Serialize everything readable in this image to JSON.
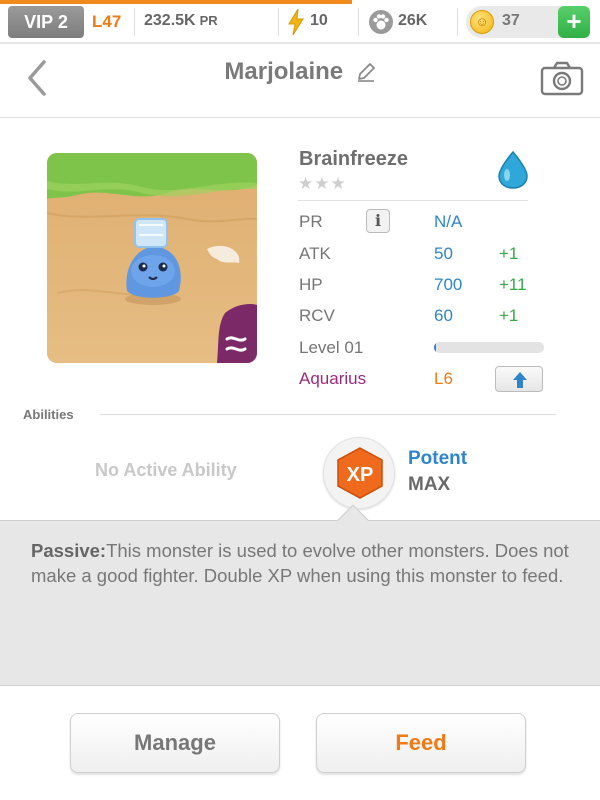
{
  "topbar": {
    "vip": "VIP 2",
    "level": "L47",
    "pr_value": "232.5K",
    "pr_unit": "PR",
    "energy": "10",
    "food": "26K",
    "coins": "37",
    "plus": "+"
  },
  "header": {
    "title": "Marjolaine"
  },
  "monster": {
    "name": "Brainfreeze",
    "stars": "★★★",
    "element": "water-drop-icon",
    "stats": {
      "pr_label": "PR",
      "pr_value": "N/A",
      "atk_label": "ATK",
      "atk_value": "50",
      "atk_bonus": "+1",
      "hp_label": "HP",
      "hp_value": "700",
      "hp_bonus": "+11",
      "rcv_label": "RCV",
      "rcv_value": "60",
      "rcv_bonus": "+1"
    },
    "level_label": "Level 01",
    "level_progress": 0.02,
    "sign": "Aquarius",
    "sign_level": "L6"
  },
  "abilities": {
    "label": "Abilities",
    "active": "No Active Ability",
    "passive_name": "Potent",
    "passive_level": "MAX",
    "badge_text": "XP",
    "passive_prefix": "Passive:",
    "passive_text": "This monster is used to evolve other monsters. Does not make a good fighter. Double XP when using this monster to feed."
  },
  "buttons": {
    "manage": "Manage",
    "feed": "Feed"
  },
  "colors": {
    "accent": "#f07a16",
    "blue": "#2e86c9",
    "green": "#35a84a",
    "purple": "#9b2a7e"
  }
}
